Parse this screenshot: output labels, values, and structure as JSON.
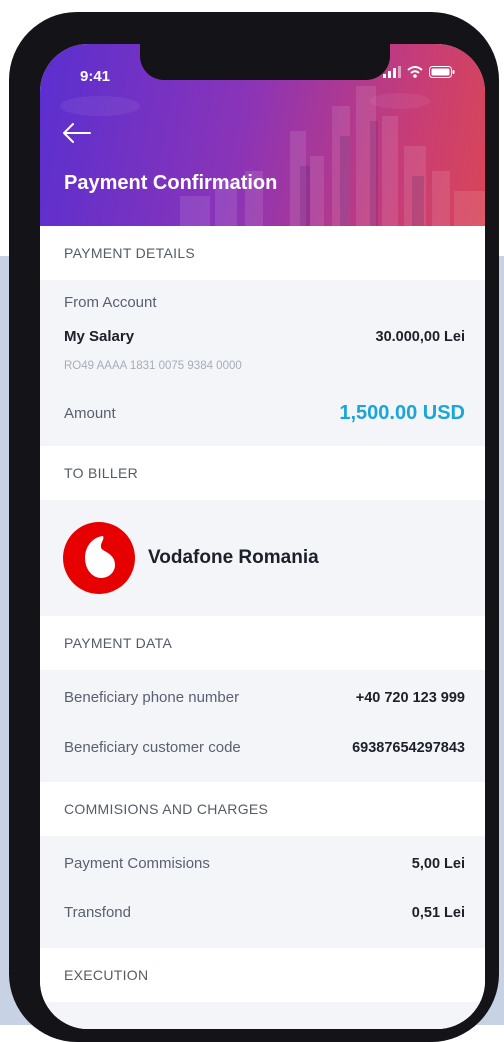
{
  "status_bar": {
    "time": "9:41"
  },
  "header": {
    "title": "Payment Confirmation"
  },
  "payment_details": {
    "heading": "PAYMENT DETAILS",
    "from_label": "From Account",
    "account_name": "My Salary",
    "account_balance": "30.000,00 Lei",
    "iban": "RO49 AAAA 1831 0075 9384 0000",
    "amount_label": "Amount",
    "amount_value": "1,500.00 USD"
  },
  "biller": {
    "heading": "TO BILLER",
    "name": "Vodafone Romania"
  },
  "payment_data": {
    "heading": "PAYMENT DATA",
    "phone_label": "Beneficiary phone number",
    "phone_value": "+40 720 123 999",
    "code_label": "Beneficiary customer code",
    "code_value": "69387654297843"
  },
  "charges": {
    "heading": "COMMISIONS AND CHARGES",
    "commission_label": "Payment Commisions",
    "commission_value": "5,00 Lei",
    "transfond_label": "Transfond",
    "transfond_value": "0,51 Lei"
  },
  "execution": {
    "heading": "EXECUTION"
  },
  "colors": {
    "accent_amount": "#1aa6d6",
    "header_start": "#5a2fd0",
    "header_end": "#d94657",
    "vodafone_red": "#e60000"
  },
  "icons": [
    "back-arrow-icon",
    "signal-icon",
    "wifi-icon",
    "battery-icon",
    "vodafone-logo"
  ]
}
